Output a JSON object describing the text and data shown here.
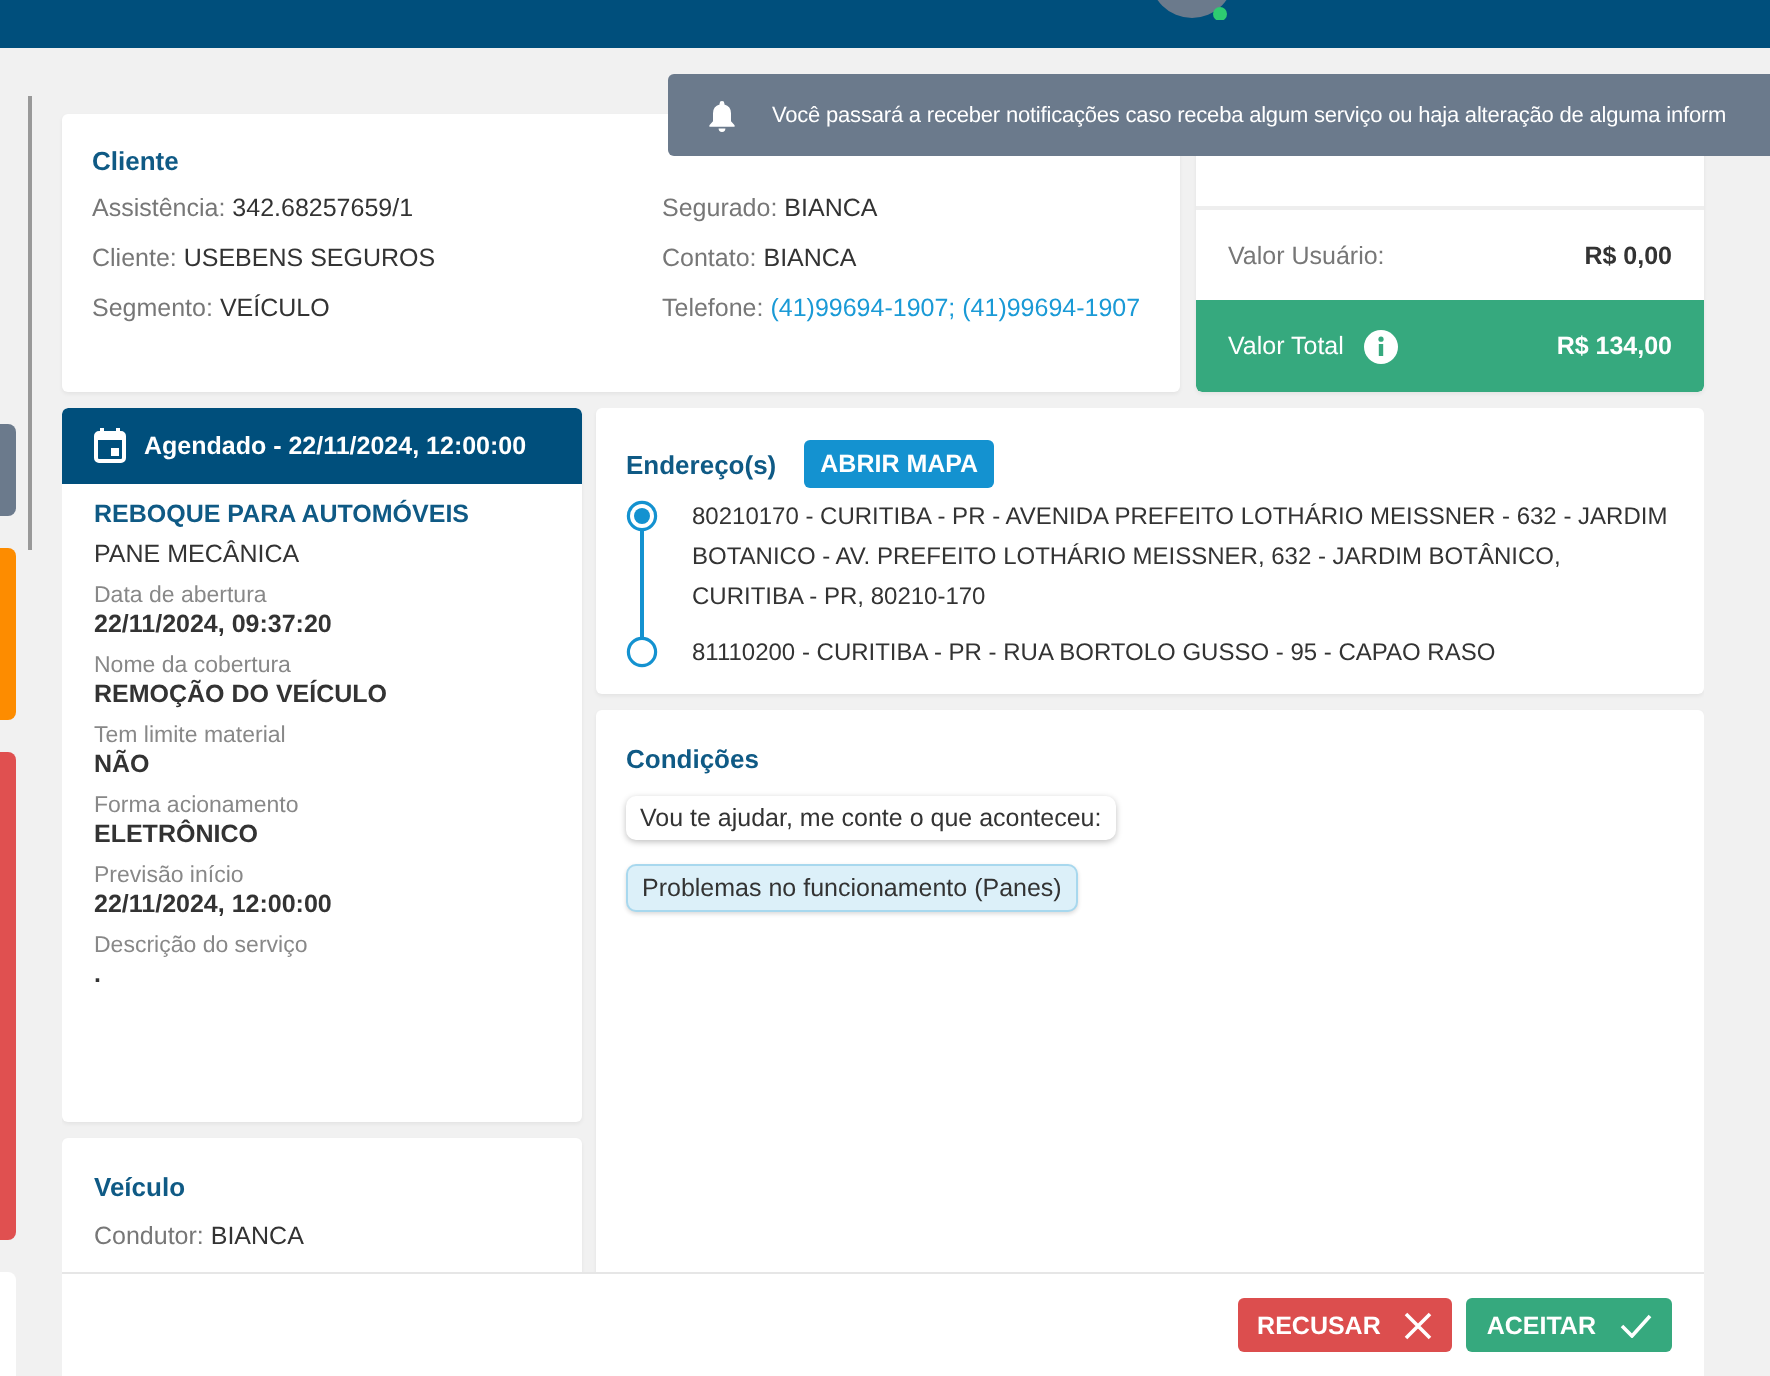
{
  "side_tabs": [
    {
      "color": "#6b7a8c"
    },
    {
      "color": "#fd8c00"
    },
    {
      "color": "#e05050"
    },
    {
      "color": "#ffffff"
    }
  ],
  "notification": {
    "text": "Você passará a receber notificações caso receba algum serviço ou haja alteração de alguma inform"
  },
  "client": {
    "title": "Cliente",
    "left_fields": [
      {
        "label": "Assistência:",
        "value": "342.68257659/1",
        "kind": "text"
      },
      {
        "label": "Cliente:",
        "value": "USEBENS SEGUROS",
        "kind": "text"
      },
      {
        "label": "Segmento:",
        "value": "VEÍCULO",
        "kind": "text"
      }
    ],
    "right_fields": [
      {
        "label": "Segurado:",
        "value": "BIANCA",
        "kind": "text"
      },
      {
        "label": "Contato:",
        "value": "BIANCA",
        "kind": "text"
      },
      {
        "label": "Telefone:",
        "value": "(41)99694-1907; (41)99694-1907",
        "kind": "link"
      }
    ]
  },
  "values": [
    {
      "label": "Valor Usuário:",
      "value": "R$ 0,00",
      "kind": "plain"
    },
    {
      "label": "Valor Total",
      "value": "R$ 134,00",
      "kind": "total"
    }
  ],
  "service": {
    "status": "Agendado - 22/11/2024, 12:00:00",
    "title": "REBOQUE PARA AUTOMÓVEIS",
    "subtitle": "PANE MECÂNICA",
    "fields": [
      {
        "label": "Data de abertura",
        "value": "22/11/2024, 09:37:20"
      },
      {
        "label": "Nome da cobertura",
        "value": "REMOÇÃO DO VEÍCULO"
      },
      {
        "label": "Tem limite material",
        "value": "NÃO"
      },
      {
        "label": "Forma acionamento",
        "value": "ELETRÔNICO"
      },
      {
        "label": "Previsão início",
        "value": "22/11/2024, 12:00:00"
      },
      {
        "label": "Descrição do serviço",
        "value": "."
      }
    ]
  },
  "vehicle": {
    "title": "Veículo",
    "fields": [
      {
        "label": "Condutor:",
        "value": "BIANCA"
      }
    ]
  },
  "addresses": {
    "title": "Endereço(s)",
    "button": "ABRIR MAPA",
    "items": [
      {
        "text": "80210170 - CURITIBA - PR - AVENIDA PREFEITO LOTHÁRIO MEISSNER - 632 - JARDIM BOTANICO - AV. PREFEITO LOTHÁRIO MEISSNER, 632 - JARDIM BOTÂNICO, CURITIBA - PR, 80210-170",
        "active": true
      },
      {
        "text": "81110200 - CURITIBA - PR - RUA BORTOLO GUSSO - 95 - CAPAO RASO",
        "active": false
      }
    ]
  },
  "conditions": {
    "title": "Condições",
    "messages": [
      {
        "kind": "question",
        "text": "Vou te ajudar, me conte o que aconteceu:"
      },
      {
        "kind": "answer",
        "text": "Problemas no funcionamento (Panes)"
      }
    ]
  },
  "actions": [
    {
      "label": "RECUSAR",
      "kind": "reject"
    },
    {
      "label": "ACEITAR",
      "kind": "accept"
    }
  ]
}
